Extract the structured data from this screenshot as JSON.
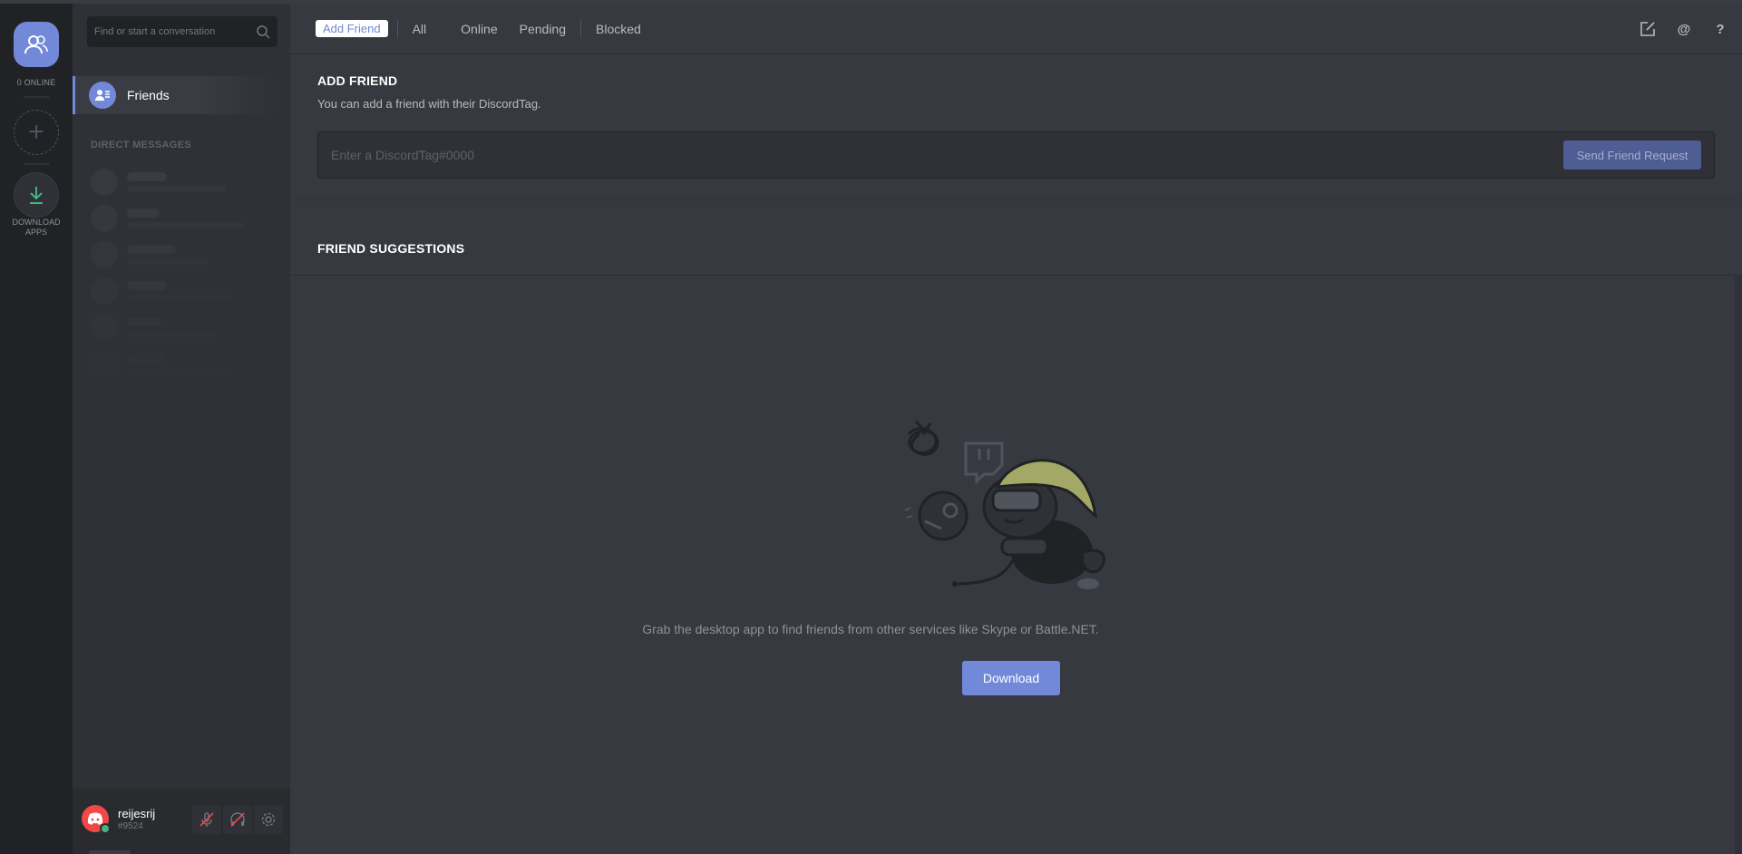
{
  "rail": {
    "online_count": "0 ONLINE",
    "add_server_symbol": "+",
    "download_label_1": "DOWNLOAD",
    "download_label_2": "APPS"
  },
  "sidebar": {
    "search_placeholder": "Find or start a conversation",
    "friends_label": "Friends",
    "dm_header": "DIRECT MESSAGES"
  },
  "user": {
    "name": "reijesrij",
    "tag": "#9524"
  },
  "topbar": {
    "tabs": {
      "add_friend": "Add Friend",
      "all": "All",
      "online": "Online",
      "pending": "Pending",
      "blocked": "Blocked"
    },
    "mention_symbol": "@",
    "help_symbol": "?"
  },
  "add_friend": {
    "title": "ADD FRIEND",
    "description": "You can add a friend with their DiscordTag.",
    "input_placeholder": "Enter a DiscordTag#0000",
    "send_button": "Send Friend Request"
  },
  "suggestions": {
    "title": "FRIEND SUGGESTIONS",
    "message": "Grab the desktop app to find friends from other services like Skype or Battle.NET.",
    "download_button": "Download"
  },
  "colors": {
    "accent": "#7289da",
    "background": "#36393f",
    "sidebar": "#2f3136",
    "rail": "#202225",
    "online": "#43b581",
    "user_avatar": "#f04747"
  },
  "icons": [
    "friends-icon",
    "search-icon",
    "plus-icon",
    "download-icon",
    "new-dm-icon",
    "mention-icon",
    "help-icon",
    "mute-icon",
    "deafen-icon",
    "gear-icon"
  ]
}
